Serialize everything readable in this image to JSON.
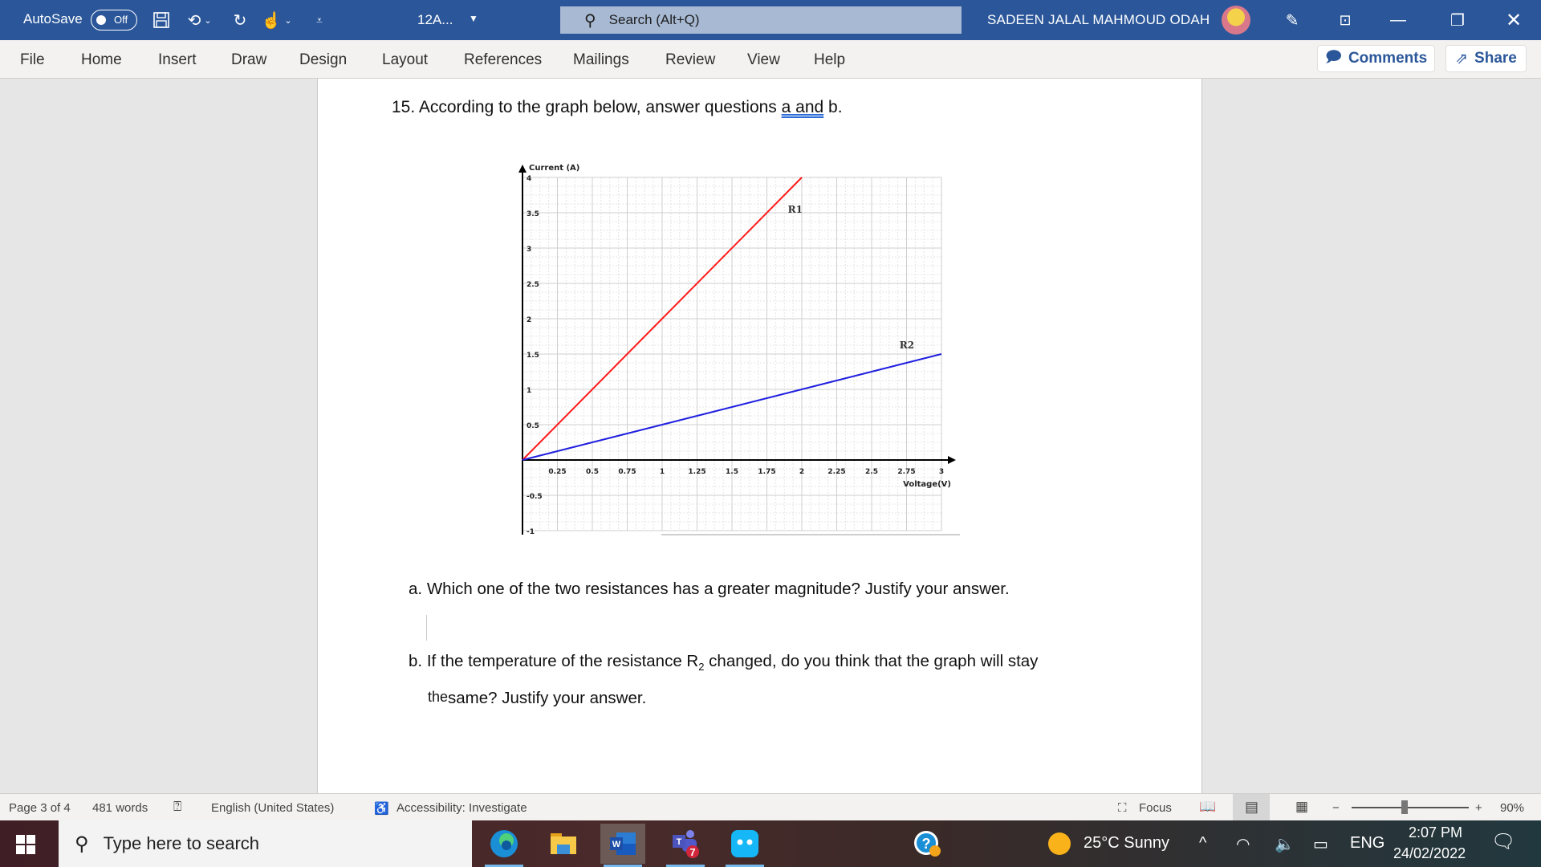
{
  "titlebar": {
    "autosave_label": "AutoSave",
    "autosave_state": "Off",
    "doc_name": "12A...",
    "search_placeholder": "Search (Alt+Q)",
    "user_name": "SADEEN JALAL MAHMOUD ODAH",
    "icons": [
      "save-icon",
      "undo-icon",
      "redo-icon",
      "touch-mode-icon",
      "customize-qat-icon",
      "pen-icon",
      "ribbon-display-icon",
      "minimize-icon",
      "restore-icon",
      "close-icon"
    ]
  },
  "ribbon": {
    "tabs": [
      "File",
      "Home",
      "Insert",
      "Draw",
      "Design",
      "Layout",
      "References",
      "Mailings",
      "Review",
      "View",
      "Help"
    ],
    "comments_label": "Comments",
    "share_label": "Share"
  },
  "document": {
    "q15_prefix": "15. According to the graph below, answer questions ",
    "q15_underlined": "a and",
    "q15_suffix": " b.",
    "qa_marker": "a.",
    "qa_text": "Which one of the two resistances has a greater magnitude? Justify your answer.",
    "qb_marker": "b.",
    "qb_text_1": "If the temperature of the resistance R",
    "qb_sub": "2",
    "qb_text_2": " changed, do you think that the graph will stay",
    "qb_line2_small": "the",
    "qb_line2": "same? Justify your answer."
  },
  "chart_data": {
    "type": "line",
    "title": "",
    "xlabel": "Voltage(V)",
    "ylabel": "Current (A)",
    "xlim": [
      0,
      3
    ],
    "ylim": [
      -1,
      4
    ],
    "grid": true,
    "x_ticks": [
      "0.25",
      "0.5",
      "0.75",
      "1",
      "1.25",
      "1.5",
      "1.75",
      "2",
      "2.25",
      "2.5",
      "2.75",
      "3"
    ],
    "y_ticks": [
      "-1",
      "-0.5",
      "0.5",
      "1",
      "1.5",
      "2",
      "2.5",
      "3",
      "3.5",
      "4"
    ],
    "series": [
      {
        "name": "R1",
        "color": "#ff1a1a",
        "x": [
          0,
          2
        ],
        "y": [
          0,
          4
        ],
        "label_at": [
          1.9,
          3.5
        ]
      },
      {
        "name": "R2",
        "color": "#2020e0",
        "x": [
          0,
          3
        ],
        "y": [
          0,
          1.5
        ],
        "label_at": [
          2.7,
          1.58
        ]
      }
    ]
  },
  "statusbar": {
    "page": "Page 3 of 4",
    "words": "481 words",
    "language": "English (United States)",
    "accessibility": "Accessibility: Investigate",
    "focus": "Focus",
    "zoom_minus": "−",
    "zoom_plus": "+",
    "zoom_level": "90%",
    "zoom_percent": 90
  },
  "taskbar": {
    "search_placeholder": "Type here to search",
    "apps": [
      "edge-icon",
      "file-explorer-icon",
      "word-icon",
      "teams-icon",
      "chat-app-icon",
      "help-icon"
    ],
    "teams_badge": "7",
    "weather": "25°C  Sunny",
    "language": "ENG",
    "time": "2:07 PM",
    "date": "24/02/2022"
  }
}
